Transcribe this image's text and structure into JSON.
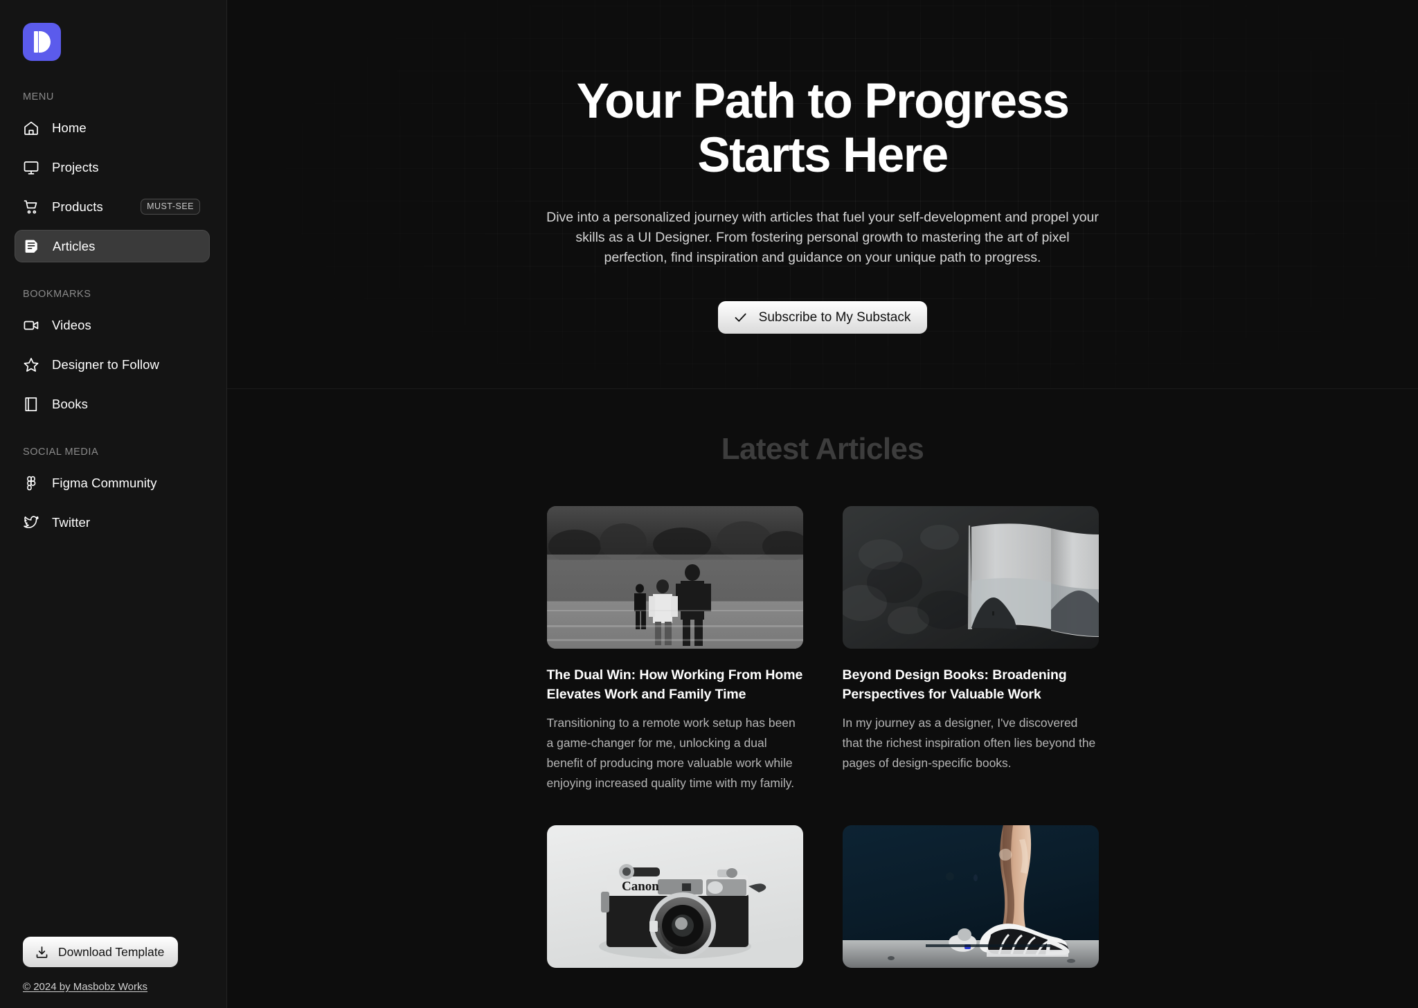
{
  "brand": {
    "logo_letter": "D",
    "accent": "#5b5bec"
  },
  "sidebar": {
    "groups": [
      {
        "label": "MENU",
        "items": [
          {
            "label": "Home",
            "icon": "home-icon",
            "active": false,
            "badge": null
          },
          {
            "label": "Projects",
            "icon": "monitor-icon",
            "active": false,
            "badge": null
          },
          {
            "label": "Products",
            "icon": "cart-icon",
            "active": false,
            "badge": "MUST-SEE"
          },
          {
            "label": "Articles",
            "icon": "article-icon",
            "active": true,
            "badge": null
          }
        ]
      },
      {
        "label": "BOOKMARKS",
        "items": [
          {
            "label": "Videos",
            "icon": "video-icon",
            "active": false,
            "badge": null
          },
          {
            "label": "Designer to Follow",
            "icon": "star-icon",
            "active": false,
            "badge": null
          },
          {
            "label": "Books",
            "icon": "book-icon",
            "active": false,
            "badge": null
          }
        ]
      },
      {
        "label": "SOCIAL MEDIA",
        "items": [
          {
            "label": "Figma Community",
            "icon": "figma-icon",
            "active": false,
            "badge": null
          },
          {
            "label": "Twitter",
            "icon": "twitter-icon",
            "active": false,
            "badge": null
          }
        ]
      }
    ],
    "footer": {
      "download_label": "Download Template",
      "download_icon": "download-icon",
      "copyright": "© 2024 by Masbobz Works"
    }
  },
  "hero": {
    "title_line1": "Your Path to Progress",
    "title_line2": "Starts Here",
    "subtitle": "Dive into a personalized journey with articles that fuel your self-development and propel your skills as a UI Designer. From fostering personal growth to mastering the art of pixel perfection, find inspiration and guidance on your unique path to progress.",
    "cta_label": "Subscribe to My Substack",
    "cta_icon": "check-icon"
  },
  "latest": {
    "heading": "Latest Articles",
    "articles": [
      {
        "thumb": "children-running-field-bw-photo",
        "title": "The Dual Win: How Working From Home Elevates Work and Family Time",
        "desc": "Transitioning to a remote work setup has been a game-changer for me, unlocking a dual benefit of producing more valuable work while enjoying increased quality time with my family."
      },
      {
        "thumb": "open-book-dark-texture-photo",
        "title": "Beyond Design Books: Broadening Perspectives for Valuable Work",
        "desc": "In my journey as a designer, I've discovered that the richest inspiration often lies beyond the pages of design-specific books."
      },
      {
        "thumb": "vintage-canon-camera-photo",
        "title": "",
        "desc": ""
      },
      {
        "thumb": "running-shoes-night-photo",
        "title": "",
        "desc": ""
      }
    ]
  }
}
